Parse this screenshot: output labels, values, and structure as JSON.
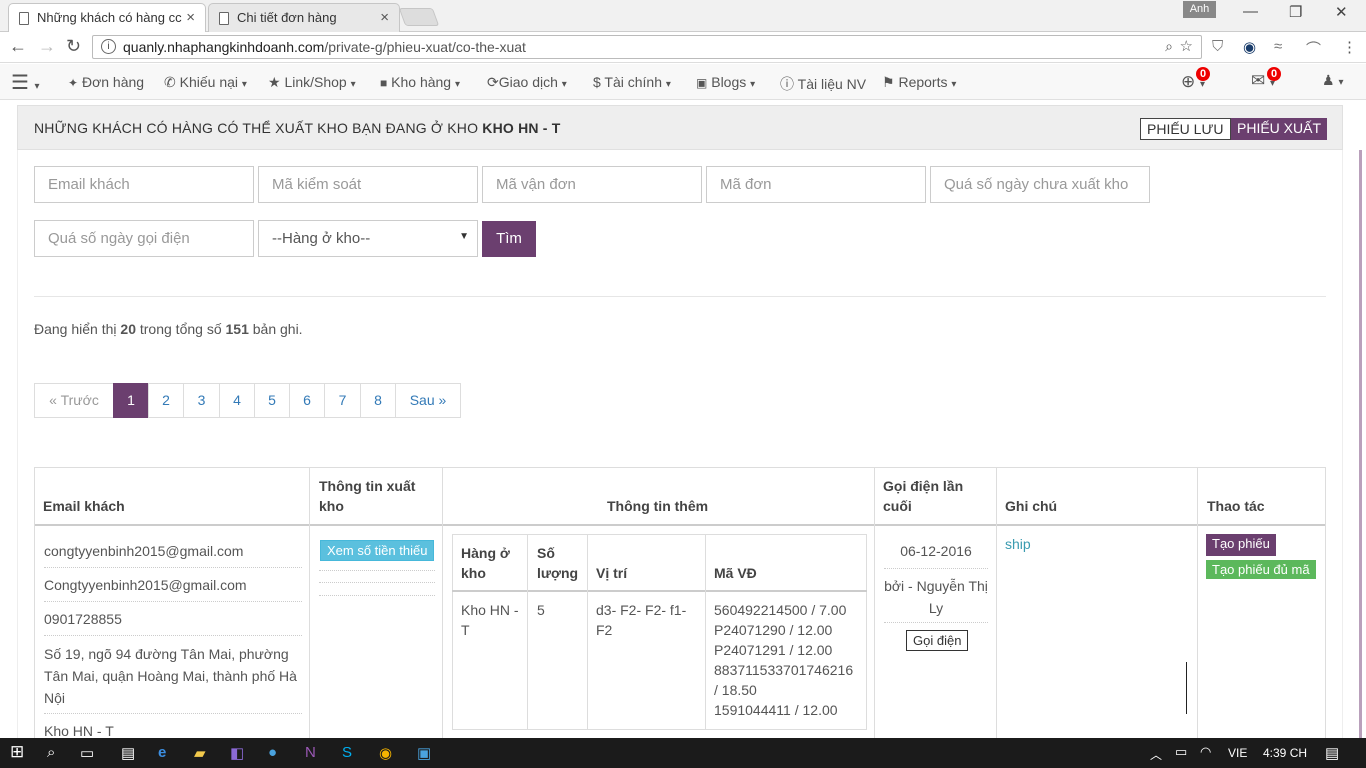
{
  "browser": {
    "tabs": [
      {
        "title": "Những khách có hàng cc"
      },
      {
        "title": "Chi tiết đơn hàng"
      }
    ],
    "user_badge": "Anh",
    "url_host": "quanly.nhaphangkinhdoanh.com",
    "url_path": "/private-g/phieu-xuat/co-the-xuat"
  },
  "nav": {
    "items": [
      {
        "label": "Đơn hàng"
      },
      {
        "label": "Khiếu nại"
      },
      {
        "label": "Link/Shop"
      },
      {
        "label": "Kho hàng"
      },
      {
        "label": "Giao dịch"
      },
      {
        "label": "$ Tài chính"
      },
      {
        "label": "Blogs"
      },
      {
        "label": "Tài liệu NV"
      },
      {
        "label": "Reports"
      }
    ],
    "globe_count": "0",
    "mail_count": "0"
  },
  "header": {
    "title_prefix": "NHỮNG KHÁCH CÓ HÀNG CÓ THỂ XUẤT KHO BẠN ĐANG Ở KHO",
    "title_bold": "KHO HN - T",
    "btn_luu": "PHIẾU LƯU",
    "btn_xuat": "PHIẾU XUẤT"
  },
  "filters": {
    "email": "Email khách",
    "ma_kiem_soat": "Mã kiểm soát",
    "ma_van_don": "Mã vận đơn",
    "ma_don": "Mã đơn",
    "qua_so_ngay_chua_xuat": "Quá số ngày chưa xuất kho",
    "qua_so_ngay_goi_dien": "Quá số ngày gọi điện",
    "kho_select": "--Hàng ở kho--",
    "search_btn": "Tìm"
  },
  "summary": {
    "prefix": "Đang hiển thị",
    "shown": "20",
    "middle": "trong tổng số",
    "total": "151",
    "suffix": "bản ghi."
  },
  "pagination": {
    "prev": "« Trước",
    "pages": [
      "1",
      "2",
      "3",
      "4",
      "5",
      "6",
      "7",
      "8"
    ],
    "current": "1",
    "next": "Sau »"
  },
  "table": {
    "headers": {
      "email": "Email khách",
      "xuat_kho": "Thông tin xuất kho",
      "them": "Thông tin thêm",
      "goi_dien": "Gọi điện lần cuối",
      "ghi_chu": "Ghi chú",
      "thao_tac": "Thao tác"
    },
    "row": {
      "email": "congtyyenbinh2015@gmail.com",
      "email2": "Congtyyenbinh2015@gmail.com",
      "phone": "0901728855",
      "address": "Số 19, ngõ 94 đường Tân Mai, phường Tân Mai, quận Hoàng Mai, thành phố Hà Nội",
      "kho": "Kho HN - T",
      "btn_xem": "Xem số tiền thiếu",
      "inner_headers": {
        "hang_o_kho": "Hàng ở kho",
        "so_luong": "Số lượng",
        "vi_tri": "Vị trí",
        "ma_vd": "Mã VĐ"
      },
      "inner": {
        "hang_o_kho": "Kho HN - T",
        "so_luong": "5",
        "vi_tri": "d3- F2- F2- f1- F2",
        "ma_vd": [
          "560492214500 / 7.00",
          "P24071290 / 12.00",
          "P24071291 / 12.00",
          "883711533701746216",
          "/ 18.50",
          "1591044411 / 12.00"
        ]
      },
      "call_date": "06-12-2016",
      "call_by": "bởi - Nguyễn Thị Ly",
      "btn_goi": "Gọi điện",
      "note": "ship",
      "btn_tao": "Tạo phiếu",
      "btn_tao_du": "Tạo phiếu đủ mã"
    }
  },
  "taskbar": {
    "lang": "VIE",
    "time": "4:39 CH"
  }
}
